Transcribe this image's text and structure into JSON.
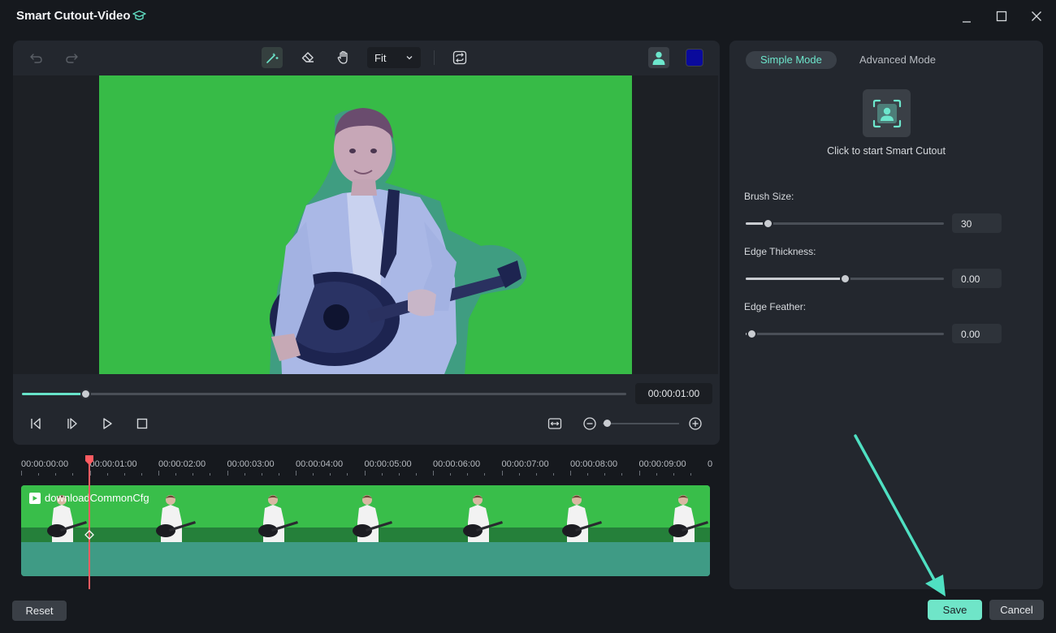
{
  "window": {
    "title": "Smart Cutout-Video",
    "title_icon": "graduation-cap-icon",
    "controls": [
      "minimize-icon",
      "maximize-icon",
      "close-icon"
    ]
  },
  "toolbar": {
    "icons": [
      "undo-icon",
      "redo-icon",
      "smart-brush-icon",
      "eraser-icon",
      "hand-icon",
      "swap-icon",
      "person-preview-icon",
      "color-swatch-icon"
    ],
    "zoom_value": "Fit",
    "swatch_color": "#0a0a9c"
  },
  "player": {
    "timecode": "00:00:01:00",
    "progress": 0.105,
    "controls": [
      "prev-frame-icon",
      "next-frame-icon",
      "play-icon",
      "stop-icon",
      "fit-width-icon",
      "zoom-out-icon",
      "zoom-in-icon"
    ],
    "zoom_level": 0.05
  },
  "timeline": {
    "ticks": [
      "00:00:00:00",
      "00:00:01:00",
      "00:00:02:00",
      "00:00:03:00",
      "00:00:04:00",
      "00:00:05:00",
      "00:00:06:00",
      "00:00:07:00",
      "00:00:08:00",
      "00:00:09:00",
      "0"
    ],
    "clip_name": "downloadCommonCfg",
    "playhead": "00:00:01:00"
  },
  "side": {
    "tabs": [
      "Simple Mode",
      "Advanced Mode"
    ],
    "active_tab": "Simple Mode",
    "cutout_caption": "Click to start Smart Cutout",
    "params": [
      {
        "label": "Brush Size:",
        "value": "30",
        "fraction": 0.11
      },
      {
        "label": "Edge Thickness:",
        "value": "0.00",
        "fraction": 0.5
      },
      {
        "label": "Edge Feather:",
        "value": "0.00",
        "fraction": 0.03
      }
    ]
  },
  "footer": {
    "reset_label": "Reset",
    "save_label": "Save",
    "cancel_label": "Cancel"
  },
  "colors": {
    "accent": "#6fe5c8",
    "chroma_green": "#37bb47",
    "playhead": "#ff5b61"
  }
}
